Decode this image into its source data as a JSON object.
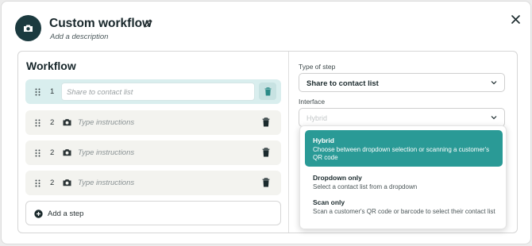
{
  "header": {
    "title": "Custom workflow",
    "subtitle": "Add a description"
  },
  "workflow": {
    "title": "Workflow",
    "steps": [
      {
        "number": "1",
        "value": "Share to contact list",
        "active": true
      },
      {
        "number": "2",
        "placeholder": "Type instructions",
        "active": false
      },
      {
        "number": "2",
        "placeholder": "Type instructions",
        "active": false
      },
      {
        "number": "2",
        "placeholder": "Type instructions",
        "active": false
      }
    ],
    "add_step_label": "Add a step"
  },
  "step_settings": {
    "type_label": "Type of step",
    "type_value": "Share to contact list",
    "interface_label": "Interface",
    "interface_placeholder": "Hybrid",
    "options": [
      {
        "title": "Hybrid",
        "description": "Choose between dropdown selection or scanning a customer's QR code",
        "selected": true
      },
      {
        "title": "Dropdown only",
        "description": "Select a contact list from a dropdown",
        "selected": false
      },
      {
        "title": "Scan only",
        "description": "Scan a customer's QR code or barcode to select their contact list",
        "selected": false
      }
    ]
  },
  "icons": {
    "avatar": "camera-icon",
    "edit": "pencil-icon",
    "close": "close-icon",
    "drag": "drag-handle-icon",
    "step": "camera-icon",
    "delete": "trash-icon",
    "add": "plus-circle-icon",
    "dropdown": "chevron-down-icon"
  },
  "colors": {
    "brand_dark": "#1b3a3f",
    "accent_teal": "#2a9a96",
    "active_row": "#d9eeee"
  }
}
